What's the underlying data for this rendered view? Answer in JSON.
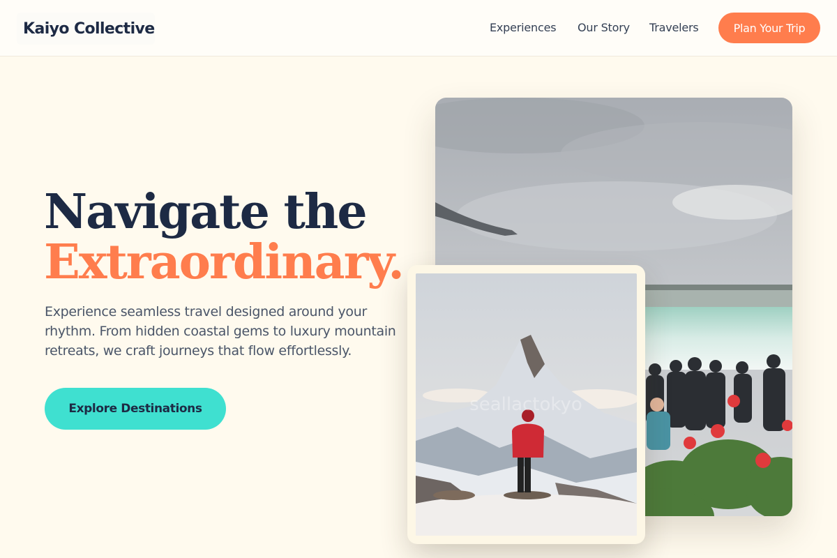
{
  "header": {
    "logo": "Kaiyo Collective",
    "nav": [
      {
        "label": "Experiences"
      },
      {
        "label": "Our Story"
      },
      {
        "label": "Travelers"
      }
    ],
    "cta_label": "Plan Your Trip"
  },
  "hero": {
    "headline_line1": "Navigate the",
    "headline_line2": "Extraordinary.",
    "subtext": "Experience seamless travel designed around your rhythm. From hidden coastal gems to luxury mountain retreats, we craft journeys that flow effortlessly.",
    "button_label": "Explore Destinations"
  },
  "images": {
    "large_photo": "waterfall-crowd-photo",
    "small_photo": "mountain-hiker-photo",
    "small_photo_watermark": "seallactokyo"
  },
  "colors": {
    "accent": "#ff7d4d",
    "teal": "#3fe0d0",
    "navy": "#1d2a44",
    "background": "#fffaee"
  }
}
